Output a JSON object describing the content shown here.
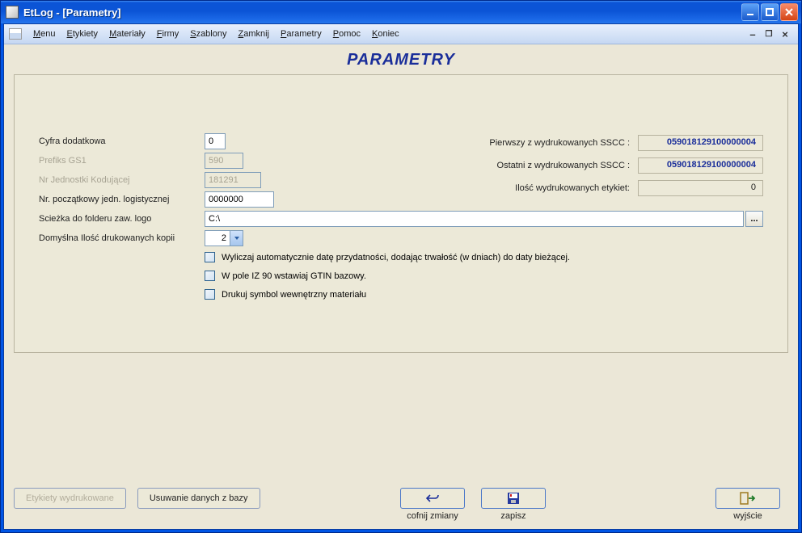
{
  "window": {
    "title": "EtLog - [Parametry]"
  },
  "menu": {
    "items": [
      "Menu",
      "Etykiety",
      "Materiały",
      "Firmy",
      "Szablony",
      "Zamknij",
      "Parametry",
      "Pomoc",
      "Koniec"
    ]
  },
  "page": {
    "title": "PARAMETRY"
  },
  "form": {
    "labels": {
      "cyfra": "Cyfra dodatkowa",
      "prefiks": "Prefiks GS1",
      "jednostka": "Nr Jednostki Kodującej",
      "poczatkowy": "Nr. początkowy jedn. logistycznej",
      "sciezka": "Scieżka do folderu zaw. logo",
      "kopie": "Domyślna Ilość drukowanych kopii"
    },
    "values": {
      "cyfra": "0",
      "prefiks": "590",
      "jednostka": "181291",
      "poczatkowy": "0000000",
      "sciezka": "C:\\",
      "kopie": "2"
    },
    "browse": "...",
    "checks": {
      "auto_date": "Wyliczaj automatycznie datę przydatności, dodając trwałość (w dniach) do daty bieżącej.",
      "iz90": "W pole IZ 90 wstawiaj GTIN bazowy.",
      "symbol": "Drukuj symbol wewnętrzny materiału"
    }
  },
  "stats": {
    "first_label": "Pierwszy z wydrukowanych SSCC :",
    "first_value": "059018129100000004",
    "last_label": "Ostatni z wydrukowanych SSCC :",
    "last_value": "059018129100000004",
    "count_label": "Ilość wydrukowanych etykiet:",
    "count_value": "0"
  },
  "buttons": {
    "etykiety": "Etykiety wydrukowane",
    "usuwanie": "Usuwanie danych z bazy",
    "undo": "cofnij zmiany",
    "save": "zapisz",
    "exit": "wyjście"
  }
}
